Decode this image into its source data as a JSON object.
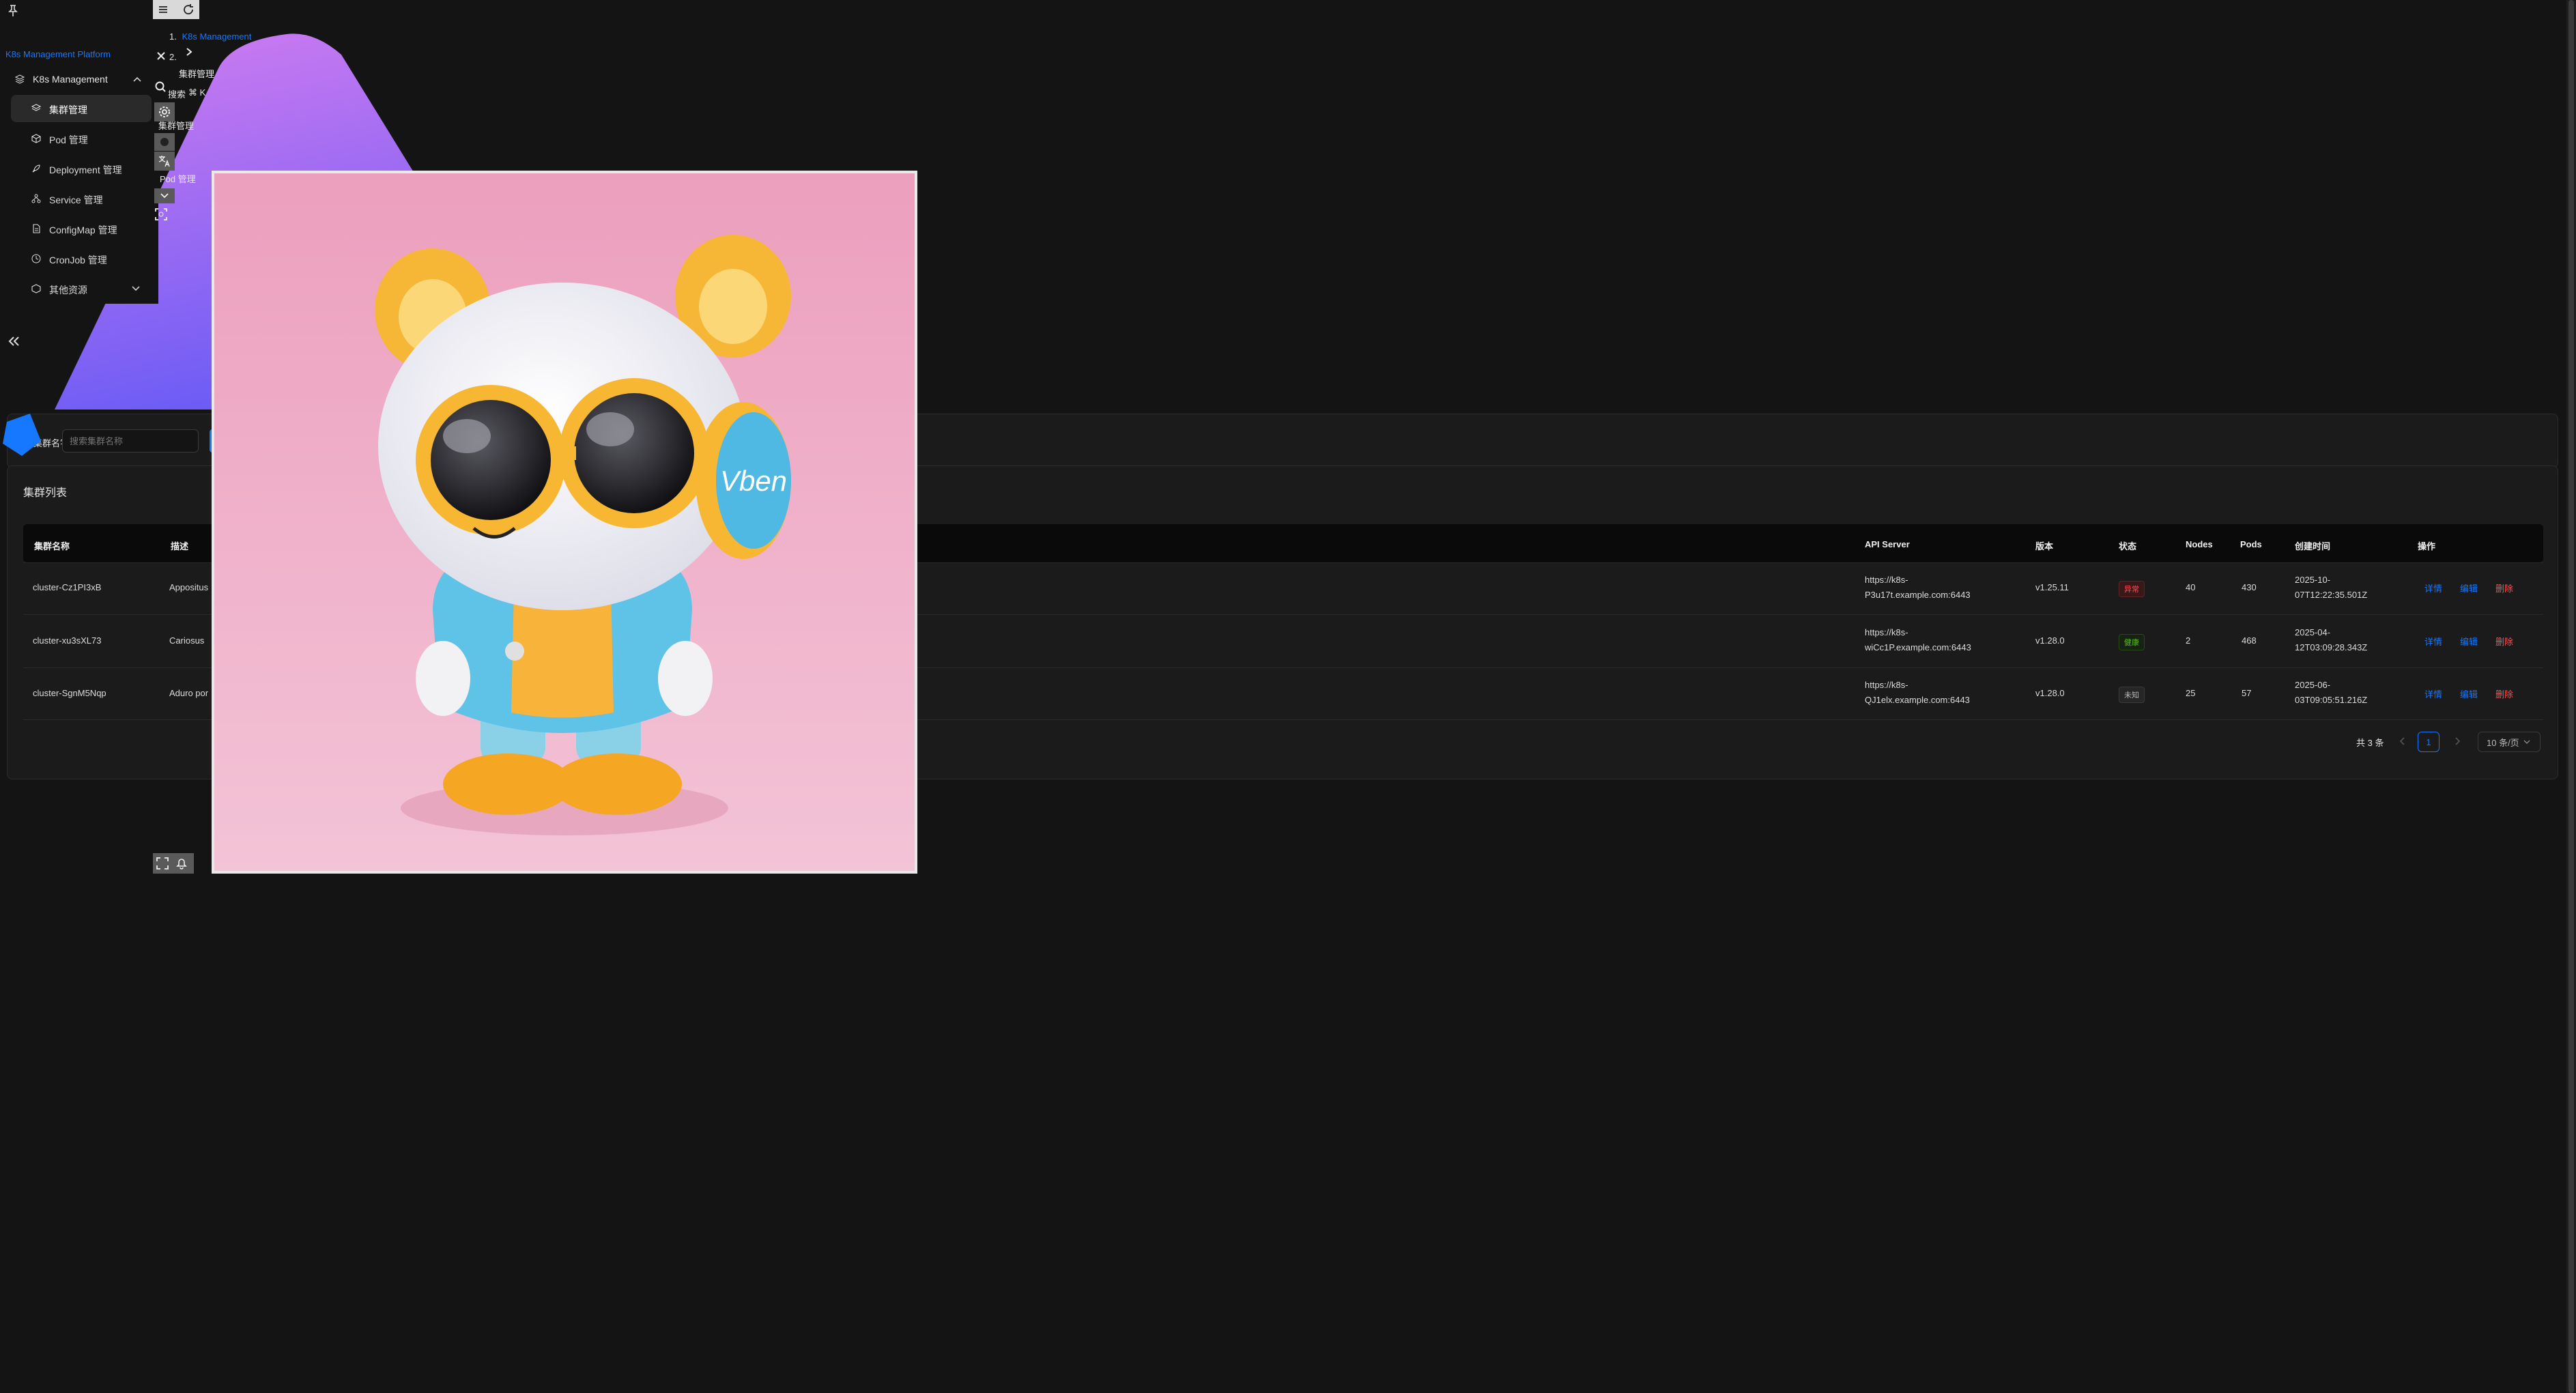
{
  "app": {
    "platform_title": "K8s Management Platform",
    "colors": {
      "accent": "#1677ff",
      "danger": "#ff4d4f",
      "success": "#52c41a",
      "bg": "#141414",
      "card": "#1b1b1b"
    }
  },
  "sidebar": {
    "pin_icon": "pin-icon",
    "group": {
      "label": "K8s Management",
      "icon": "layers-icon"
    },
    "items": [
      {
        "label": "集群管理",
        "icon": "layers-icon",
        "active": true
      },
      {
        "label": "Pod 管理",
        "icon": "cube-icon"
      },
      {
        "label": "Deployment 管理",
        "icon": "rocket-icon"
      },
      {
        "label": "Service 管理",
        "icon": "network-icon"
      },
      {
        "label": "ConfigMap 管理",
        "icon": "file-icon"
      },
      {
        "label": "CronJob 管理",
        "icon": "clock-icon"
      },
      {
        "label": "其他资源",
        "icon": "box-icon"
      }
    ],
    "collapse_icon": "double-chevron-left-icon"
  },
  "header": {
    "breadcrumb": {
      "index1": "1.",
      "item1": "K8s Management",
      "index2": "2.",
      "item2": "集群管理"
    },
    "search_label": "搜索",
    "search_shortcut": "⌘ K",
    "tabs": [
      {
        "label": "集群管理"
      },
      {
        "label": "Pod 管理"
      }
    ]
  },
  "filter": {
    "label": "集群名字:",
    "placeholder": "搜索集群名称"
  },
  "list": {
    "title": "集群列表",
    "columns": [
      "集群名称",
      "描述",
      "API Server",
      "版本",
      "状态",
      "Nodes",
      "Pods",
      "创建时间",
      "操作"
    ],
    "rows": [
      {
        "name": "cluster-Cz1PI3xB",
        "desc": "Appositus",
        "api1": "https://k8s-",
        "api2": "P3u17t.example.com:6443",
        "version": "v1.25.11",
        "status": "异常",
        "status_color": "#ff4d4f",
        "nodes": "40",
        "pods": "430",
        "created1": "2025-10-",
        "created2": "07T12:22:35.501Z"
      },
      {
        "name": "cluster-xu3sXL73",
        "desc": "Cariosus",
        "api1": "https://k8s-",
        "api2": "wiCc1P.example.com:6443",
        "version": "v1.28.0",
        "status": "健康",
        "status_color": "#52c41a",
        "nodes": "2",
        "pods": "468",
        "created1": "2025-04-",
        "created2": "12T03:09:28.343Z"
      },
      {
        "name": "cluster-SgnM5Nqp",
        "desc": "Aduro por",
        "api1": "https://k8s-",
        "api2": "QJ1elx.example.com:6443",
        "version": "v1.28.0",
        "status": "未知",
        "status_color": "#aaaaaa",
        "nodes": "25",
        "pods": "57",
        "created1": "2025-06-",
        "created2": "03T09:05:51.216Z"
      }
    ],
    "actions": {
      "detail": "详情",
      "edit": "编辑",
      "delete": "删除"
    }
  },
  "pagination": {
    "total": "共 3 条",
    "page": "1",
    "page_size": "10 条/页"
  },
  "overlay": {
    "badge_text": "Vben"
  }
}
